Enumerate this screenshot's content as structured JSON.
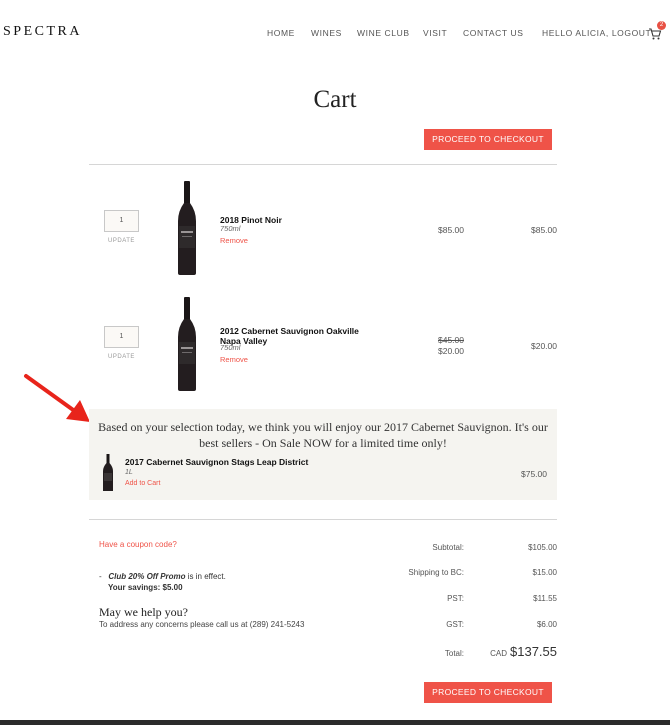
{
  "brand": {
    "logo": "SPECTRA"
  },
  "nav": {
    "items": [
      "HOME",
      "WINES",
      "WINE CLUB",
      "VISIT",
      "CONTACT US"
    ],
    "account": "HELLO ALICIA, LOGOUT",
    "cart_count": "2"
  },
  "page": {
    "title": "Cart"
  },
  "checkout_label": "PROCEED TO CHECKOUT",
  "cart": {
    "items": [
      {
        "qty": "1",
        "update": "UPDATE",
        "name": "2018 Pinot Noir",
        "size": "750ml",
        "remove": "Remove",
        "price_original": "",
        "price": "$85.00",
        "total": "$85.00"
      },
      {
        "qty": "1",
        "update": "UPDATE",
        "name": "2012 Cabernet Sauvignon Oakville Napa Valley",
        "size": "750ml",
        "remove": "Remove",
        "price_original": "$45.00",
        "price": "$20.00",
        "total": "$20.00"
      }
    ]
  },
  "recommendation": {
    "message": "Based on your selection today, we think you will enjoy our 2017 Cabernet Sauvignon. It's our best sellers - On Sale NOW for a limited time only!",
    "name": "2017 Cabernet Sauvignon Stags Leap District",
    "size": "1L",
    "add": "Add to Cart",
    "price": "$75.00"
  },
  "coupon": {
    "link": "Have a coupon code?"
  },
  "promo": {
    "dash": "-",
    "name": "Club 20% Off Promo",
    "suffix": "is in effect.",
    "savings": "Your savings: $5.00"
  },
  "help": {
    "title": "May we help you?",
    "text": "To address any concerns please call us at (289) 241-5243"
  },
  "summary": {
    "subtotal_label": "Subtotal:",
    "subtotal": "$105.00",
    "shipping_label": "Shipping to BC:",
    "shipping": "$15.00",
    "pst_label": "PST:",
    "pst": "$11.55",
    "gst_label": "GST:",
    "gst": "$6.00",
    "total_label": "Total:",
    "currency": "CAD",
    "total": "$137.55"
  },
  "colors": {
    "accent": "#ef5348",
    "reco_bg": "#f5f4f0",
    "annotation_arrow": "#e8241b"
  }
}
